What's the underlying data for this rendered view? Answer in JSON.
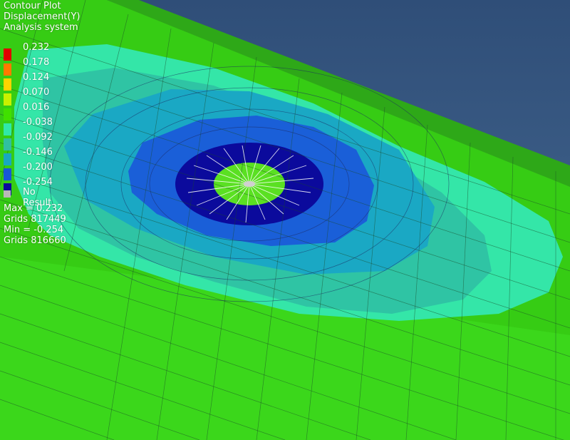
{
  "header": {
    "plot_type": "Contour Plot",
    "result": "Displacement(Y)",
    "system": "Analysis system"
  },
  "legend": {
    "entries": [
      {
        "label": "0.232",
        "color": "#e00000"
      },
      {
        "label": "0.178",
        "color": "#ff7a00"
      },
      {
        "label": "0.124",
        "color": "#ffd400"
      },
      {
        "label": "0.070",
        "color": "#c8f000"
      },
      {
        "label": "0.016",
        "color": "#40e000"
      },
      {
        "label": "-0.038",
        "color": "#30e8a8"
      },
      {
        "label": "-0.092",
        "color": "#30c0a0"
      },
      {
        "label": "-0.146",
        "color": "#18a8c0"
      },
      {
        "label": "-0.200",
        "color": "#1858d8"
      },
      {
        "label": "-0.254",
        "color": "#0a0a9a"
      }
    ],
    "no_result_label": "No Result",
    "no_result_color": "#b8b8b8"
  },
  "stats": {
    "max": "Max = 0.232",
    "max_grid": "Grids 817449",
    "min": "Min = -0.254",
    "min_grid": "Grids 816660"
  },
  "colors": {
    "background": "#3a5a84",
    "green": "#3ed41a",
    "edge": "#2a5a2a"
  }
}
